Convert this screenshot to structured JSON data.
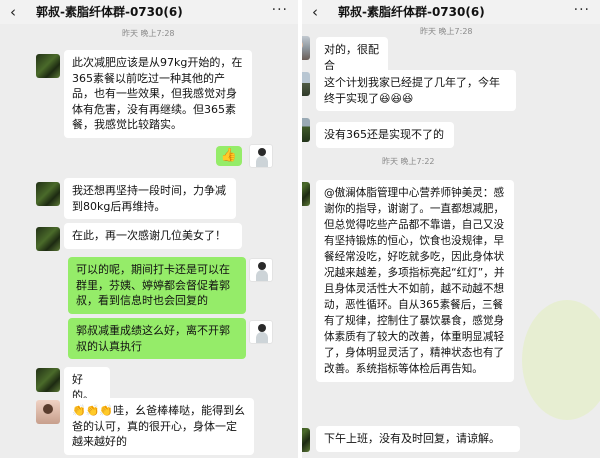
{
  "left": {
    "header": {
      "back_icon": "‹",
      "title": "郭叔-素脂纤体群-0730(6)",
      "more_icon": "···"
    },
    "time_label": "昨天 晚上7:28",
    "messages": [
      {
        "text": "此次减肥应该是从97kg开始的，在365素餐以前吃过一种其他的产品，也有一些效果，但我感觉对身体有危害，没有再继续。但365素餐，我感觉比较踏实。"
      },
      {
        "text": "👍"
      },
      {
        "text": "我还想再坚持一段时间，力争减到80kg后再维持。"
      },
      {
        "text": "在此，再一次感谢几位美女了！"
      },
      {
        "text": "可以的呢，期间打卡还是可以在群里，芬姨、婷婷都会督促着郭叔，看到信息时也会回复的"
      },
      {
        "text": "郭叔减重成绩这么好，离不开郭叔的认真执行"
      },
      {
        "text": "好的。"
      },
      {
        "text": "👏👏👏哇，幺爸棒棒哒，能得到幺爸的认可，真的很开心，身体一定越来越好的"
      }
    ]
  },
  "right": {
    "header": {
      "back_icon": "‹",
      "title": "郭叔-素脂纤体群-0730(6)",
      "more_icon": "···"
    },
    "time_label_1": "昨天 晚上7:28",
    "time_label_2": "昨天 晚上7:22",
    "messages": [
      {
        "text": "对的，很配合"
      },
      {
        "text": "这个计划我家已经提了几年了，今年终于实现了😆😆😆"
      },
      {
        "text": "没有365还是实现不了的"
      },
      {
        "text": "@傲澜体脂管理中心营养师钟美灵：感谢你的指导，谢谢了。一直都想减肥，但总觉得吃些产品都不靠谱，自己又没有坚持锻炼的恒心，饮食也没规律，早餐经常没吃，好吃就多吃，因此身体状况越来越差，多项指标亮起“红灯”，并且身体灵活性大不如前，越不动越不想动，恶性循环。自从365素餐后，三餐有了规律，控制住了暴饮暴食，感觉身体素质有了较大的改善，体重明显减轻了，身体明显灵活了，精神状态也有了改善。系统指标等体检后再告知。"
      },
      {
        "text": "下午上班，没有及时回复，请谅解。"
      }
    ]
  },
  "colors": {
    "chat_bg": "#ededed",
    "own_bubble": "#95ec69",
    "other_bubble": "#ffffff",
    "time_text": "#8a8a8a"
  }
}
